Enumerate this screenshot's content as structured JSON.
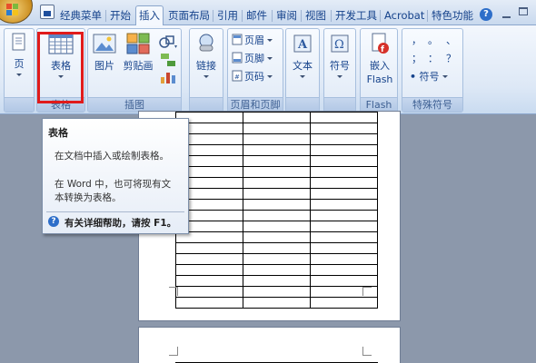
{
  "tabs": [
    {
      "label": "经典菜单"
    },
    {
      "label": "开始"
    },
    {
      "label": "插入"
    },
    {
      "label": "页面布局"
    },
    {
      "label": "引用"
    },
    {
      "label": "邮件"
    },
    {
      "label": "审阅"
    },
    {
      "label": "视图"
    },
    {
      "label": "开发工具"
    },
    {
      "label": "Acrobat"
    },
    {
      "label": "特色功能"
    }
  ],
  "active_tab": "插入",
  "ribbon": {
    "pages": {
      "button_label": "页",
      "group_label": ""
    },
    "table": {
      "button_label": "表格",
      "group_label": "表格"
    },
    "illustrations": {
      "picture_label": "图片",
      "clipart_label": "剪贴画",
      "group_label": "插图"
    },
    "links": {
      "button_label": "链接"
    },
    "header_footer": {
      "header_label": "页眉",
      "footer_label": "页脚",
      "page_number_label": "页码",
      "group_label": "页眉和页脚"
    },
    "text": {
      "button_label": "文本"
    },
    "symbols": {
      "button_label": "符号"
    },
    "flash": {
      "button_label_1": "嵌入",
      "button_label_2": "Flash",
      "group_label": "Flash"
    },
    "special_symbols": {
      "row1": [
        "，",
        "。",
        "、"
      ],
      "row2": [
        "；",
        "：",
        "？"
      ],
      "dropdown_label": "符号",
      "group_label": "特殊符号"
    }
  },
  "tooltip": {
    "title": "表格",
    "line1": "在文档中插入或绘制表格。",
    "line2": "在 Word 中，也可将现有文",
    "line3": "本转换为表格。",
    "help": "有关详细帮助，请按 F1。"
  },
  "colors": {
    "accent_red": "#e01b1b",
    "ribbon_text": "#15428b",
    "doc_background": "#8c98ab"
  },
  "document": {
    "table_rows": 18,
    "table_cols": 3
  }
}
